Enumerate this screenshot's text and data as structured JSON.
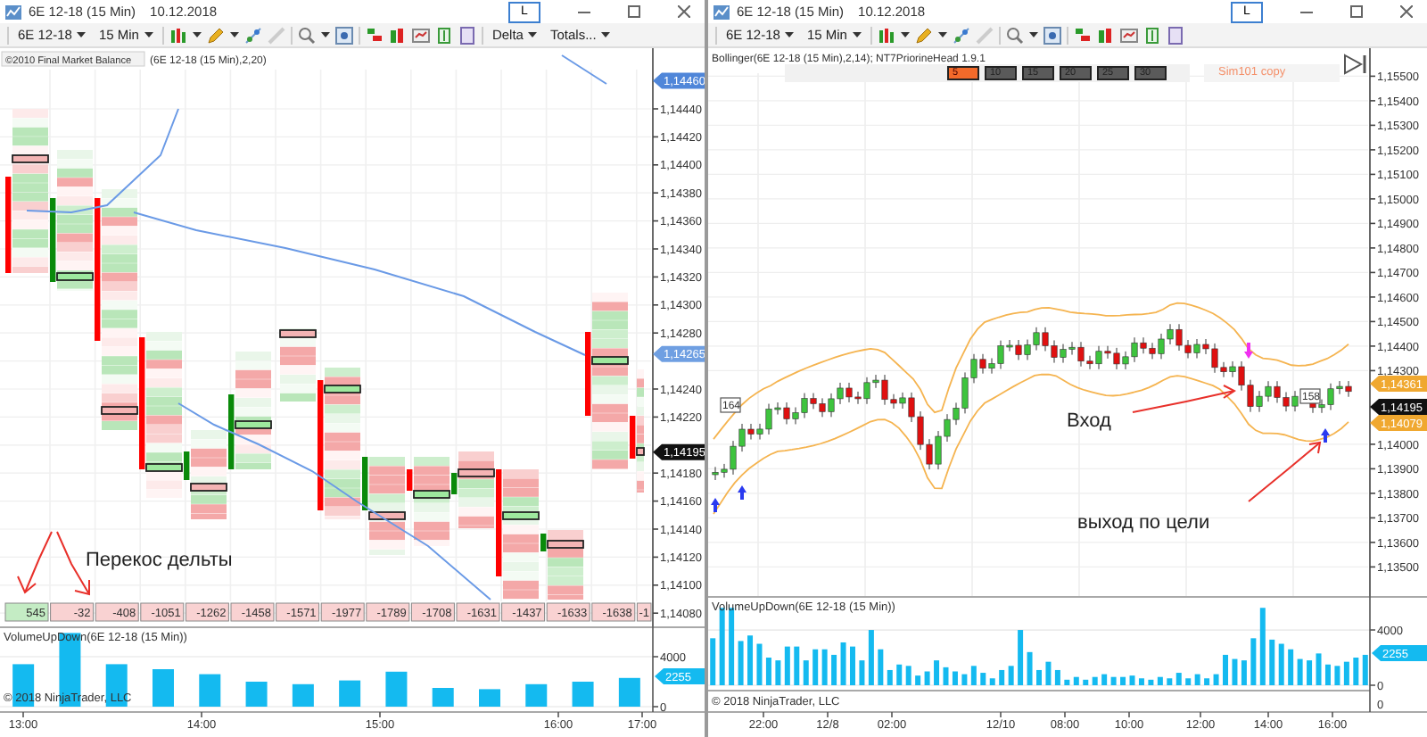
{
  "left_window": {
    "title": "6E 12-18 (15 Min)",
    "date": "10.12.2018",
    "link_button": "L",
    "toolbar": {
      "instrument": "6E 12-18",
      "interval": "15 Min",
      "menus": [
        "Delta",
        "Totals..."
      ]
    },
    "chart": {
      "kind": "footprint",
      "indicator": "©2010 Final Market Balance",
      "indicator_params": "(6E 12-18 (15 Min),2,20)",
      "price_labels": [
        "1,14440",
        "1,14420",
        "1,14400",
        "1,14380",
        "1,14360",
        "1,14340",
        "1,14320",
        "1,14300",
        "1,14280",
        "1,14240",
        "1,14220",
        "1,14180",
        "1,14160",
        "1,14140",
        "1,14120",
        "1,14100",
        "1,14080"
      ],
      "price_flags": [
        {
          "value": "1,14460",
          "color": "#4f86d9"
        },
        {
          "value": "1,14265",
          "color": "#6f9fe2"
        },
        {
          "value": "1,14195",
          "color": "#111111"
        }
      ],
      "delta_row": [
        {
          "value": "545",
          "positive": true
        },
        {
          "value": "-32",
          "positive": false
        },
        {
          "value": "-408",
          "positive": false
        },
        {
          "value": "-1051",
          "positive": false
        },
        {
          "value": "-1262",
          "positive": false
        },
        {
          "value": "-1458",
          "positive": false
        },
        {
          "value": "-1571",
          "positive": false
        },
        {
          "value": "-1977",
          "positive": false
        },
        {
          "value": "-1789",
          "positive": false
        },
        {
          "value": "-1708",
          "positive": false
        },
        {
          "value": "-1631",
          "positive": false
        },
        {
          "value": "-1437",
          "positive": false
        },
        {
          "value": "-1633",
          "positive": false
        },
        {
          "value": "-1638",
          "positive": false
        },
        {
          "value": "-1",
          "positive": false
        }
      ],
      "annotations": [
        "Перекос дельты"
      ],
      "volume_panel": {
        "title": "VolumeUpDown(6E 12-18 (15 Min))",
        "last_value": "2255",
        "copyright": "© 2018 NinjaTrader, LLC",
        "time_labels": [
          "13:00",
          "14:00",
          "15:00",
          "16:00",
          "17:00"
        ],
        "chart_data": {
          "type": "bar",
          "values": [
            3400,
            5900,
            3400,
            3000,
            2600,
            2000,
            1800,
            2100,
            2800,
            1500,
            1400,
            1800,
            2000,
            2300
          ],
          "ylim": [
            0,
            5900
          ],
          "yticks": [
            0,
            4000
          ]
        }
      }
    }
  },
  "right_window": {
    "title": "6E 12-18 (15 Min)",
    "date": "10.12.2018",
    "link_button": "L",
    "toolbar": {
      "instrument": "6E 12-18",
      "interval": "15 Min"
    },
    "chart": {
      "kind": "candles",
      "indicator": "Bollinger(6E 12-18 (15 Min),2,14); NT7PriorineHead 1.9.1",
      "period_buttons": [
        {
          "label": "5",
          "selected": true
        },
        {
          "label": "10",
          "selected": false
        },
        {
          "label": "15",
          "selected": false
        },
        {
          "label": "20",
          "selected": false
        },
        {
          "label": "25",
          "selected": false
        },
        {
          "label": "30",
          "selected": false
        }
      ],
      "account": "Sim101 copy",
      "price_labels": [
        "1,15500",
        "1,15400",
        "1,15300",
        "1,15200",
        "1,15100",
        "1,15000",
        "1,14900",
        "1,14800",
        "1,14700",
        "1,14600",
        "1,14500",
        "1,14400",
        "1,14300",
        "1,14000",
        "1,13900",
        "1,13800",
        "1,13700",
        "1,13600",
        "1,13500"
      ],
      "price_flags": [
        {
          "value": "1,14361",
          "color": "#f0a830"
        },
        {
          "value": "1,14195",
          "color": "#111111"
        },
        {
          "value": "1,14079",
          "color": "#f0a830"
        }
      ],
      "trade_labels": [
        "164",
        "158"
      ],
      "annotations": [
        "Вход",
        "выход по цели"
      ],
      "volume_panel": {
        "title": "VolumeUpDown(6E 12-18 (15 Min))",
        "last_value": "2255",
        "copyright": "© 2018 NinjaTrader, LLC",
        "lower_panel_tick": "0",
        "time_labels": [
          "22:00",
          "12/8",
          "02:00",
          "12/10",
          "08:00",
          "10:00",
          "12:00",
          "14:00",
          "16:00"
        ],
        "chart_data": {
          "type": "bar",
          "values": [
            3400,
            5600,
            5600,
            3200,
            3600,
            3000,
            2000,
            1800,
            2800,
            2800,
            1800,
            2600,
            2600,
            2200,
            3100,
            2800,
            1800,
            4000,
            2600,
            1100,
            1500,
            1400,
            700,
            1000,
            1800,
            1300,
            1000,
            800,
            1400,
            900,
            500,
            1100,
            1400,
            4000,
            2400,
            1100,
            1700,
            1100,
            400,
            600,
            400,
            600,
            800,
            600,
            600,
            700,
            500,
            400,
            600,
            500,
            900,
            500,
            800,
            500,
            800,
            2200,
            1900,
            1800,
            3400,
            5600,
            3300,
            3000,
            2600,
            1900,
            1800,
            2300,
            1500,
            1400,
            1700,
            2000,
            2200
          ],
          "ylim": [
            0,
            5900
          ],
          "yticks": [
            0,
            4000
          ]
        }
      }
    }
  }
}
